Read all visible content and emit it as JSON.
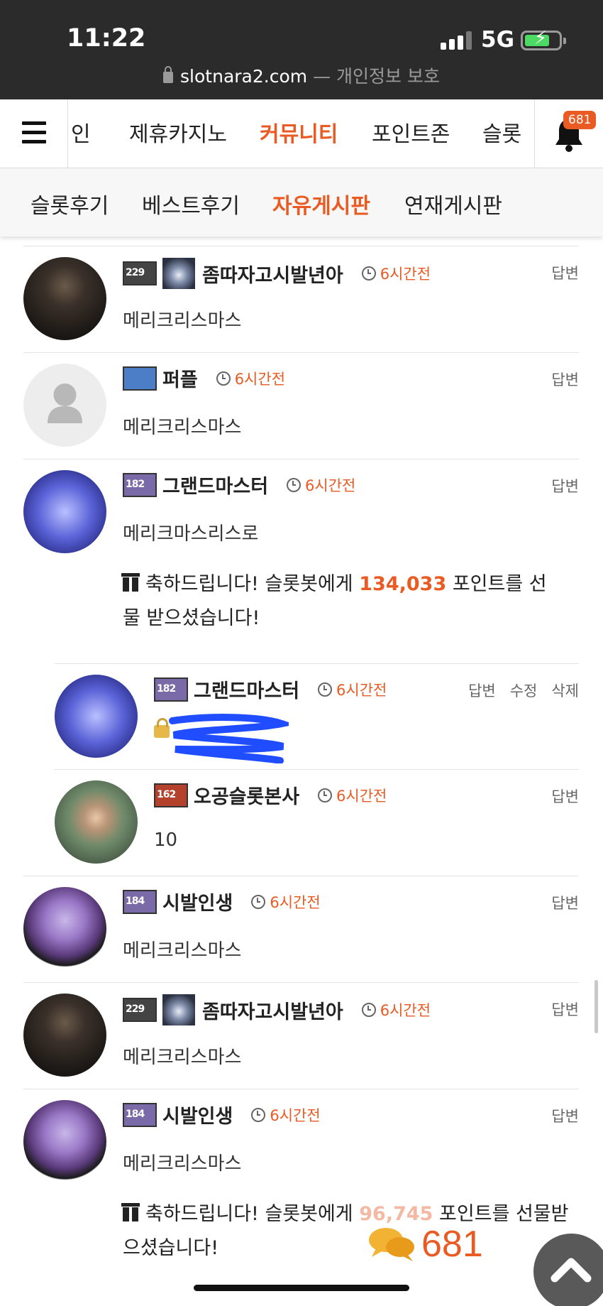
{
  "status_bar": {
    "time": "11:22",
    "network": "5G",
    "url": "slotnara2.com",
    "privacy": "— 개인정보 보호"
  },
  "main_nav": {
    "items": [
      "인",
      "제휴카지노",
      "커뮤니티",
      "포인트존",
      "슬롯"
    ],
    "active": "커뮤니티",
    "notification_count": "681"
  },
  "sub_nav": {
    "items": [
      "슬롯후기",
      "베스트후기",
      "자유게시판",
      "연재게시판"
    ],
    "active": "자유게시판"
  },
  "comments": [
    {
      "level": "229",
      "name": "좀따자고시발년아",
      "time": "6시간전",
      "actions": [
        "답변"
      ],
      "text": "메리크리스마스"
    },
    {
      "level": "",
      "name": "퍼플",
      "time": "6시간전",
      "actions": [
        "답변"
      ],
      "text": "메리크리스마스"
    },
    {
      "level": "182",
      "name": "그랜드마스터",
      "time": "6시간전",
      "actions": [
        "답변"
      ],
      "text": "메리크마스리스로",
      "gift": {
        "prefix": "축하드립니다! 슬롯봇에게",
        "points": "134,033",
        "suffix": "포인트를 선물 받으셨습니다!"
      }
    },
    {
      "level": "182",
      "name": "그랜드마스터",
      "time": "6시간전",
      "actions": [
        "답변",
        "수정",
        "삭제"
      ],
      "text": ""
    },
    {
      "level": "162",
      "name": "오공슬롯본사",
      "time": "6시간전",
      "actions": [
        "답변"
      ],
      "text": "10"
    },
    {
      "level": "184",
      "name": "시발인생",
      "time": "6시간전",
      "actions": [
        "답변"
      ],
      "text": "메리크리스마스"
    },
    {
      "level": "229",
      "name": "좀따자고시발년아",
      "time": "6시간전",
      "actions": [
        "답변"
      ],
      "text": "메리크리스마스"
    },
    {
      "level": "184",
      "name": "시발인생",
      "time": "6시간전",
      "actions": [
        "답변"
      ],
      "text": "메리크리스마스",
      "gift": {
        "prefix": "축하드립니다! 슬롯봇에게",
        "points": "96,745",
        "suffix": "포인트를 선물받으셨습니다!"
      }
    }
  ],
  "floating_comment_count": "681",
  "colors": {
    "accent": "#e95b23",
    "status_bar": "#2b2b2b"
  }
}
